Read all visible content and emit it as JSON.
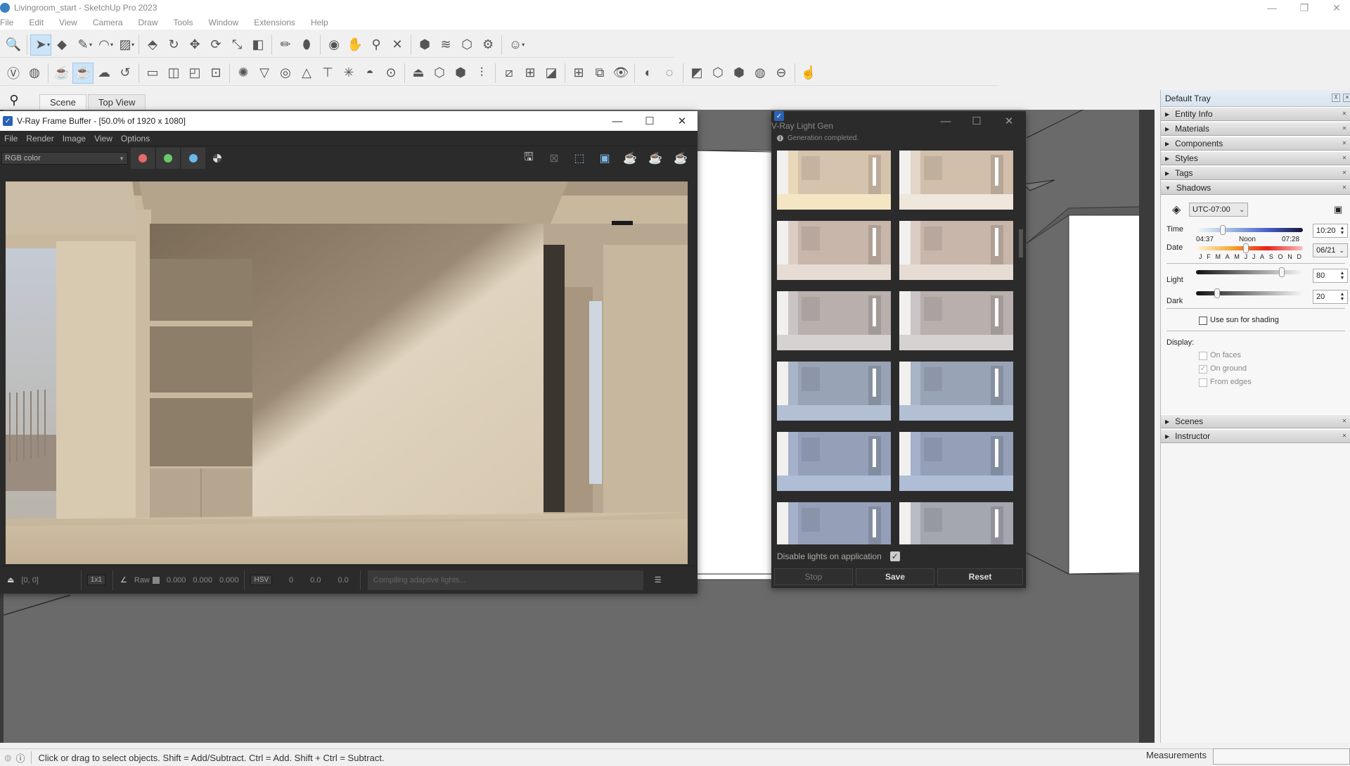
{
  "app": {
    "title": "Livingroom_start - SketchUp Pro 2023",
    "window_controls": [
      "minimize",
      "restore",
      "close"
    ]
  },
  "menubar": [
    "File",
    "Edit",
    "View",
    "Camera",
    "Draw",
    "Tools",
    "Window",
    "Extensions",
    "Help"
  ],
  "toolbar_row1": [
    {
      "name": "zoom-window",
      "glyph": "🔍"
    },
    {
      "name": "select",
      "glyph": "➤",
      "active": true,
      "dropdown": true
    },
    {
      "name": "eraser",
      "glyph": "◆"
    },
    {
      "name": "pencil-line",
      "glyph": "✎",
      "dropdown": true
    },
    {
      "name": "arc",
      "glyph": "◠",
      "dropdown": true
    },
    {
      "name": "rectangle",
      "glyph": "▨",
      "dropdown": true
    },
    {
      "name": "push-pull",
      "glyph": "⬘"
    },
    {
      "name": "follow-me",
      "glyph": "↻"
    },
    {
      "name": "move",
      "glyph": "✥"
    },
    {
      "name": "rotate",
      "glyph": "⟳"
    },
    {
      "name": "scale",
      "glyph": "⤡"
    },
    {
      "name": "offset",
      "glyph": "◧"
    },
    {
      "name": "tape-measure",
      "glyph": "✏"
    },
    {
      "name": "paint-bucket",
      "glyph": "⬮"
    },
    {
      "name": "orbit",
      "glyph": "◉"
    },
    {
      "name": "pan",
      "glyph": "✋"
    },
    {
      "name": "zoom",
      "glyph": "⚲"
    },
    {
      "name": "zoom-extents",
      "glyph": "✕"
    },
    {
      "name": "warehouse",
      "glyph": "⬢"
    },
    {
      "name": "extension-warehouse",
      "glyph": "≋"
    },
    {
      "name": "share-model",
      "glyph": "⬡"
    },
    {
      "name": "extension-manager",
      "glyph": "⚙"
    },
    {
      "name": "account",
      "glyph": "☺",
      "dropdown": true
    }
  ],
  "toolbar_row2": [
    {
      "name": "vray-render",
      "glyph": "Ⓥ"
    },
    {
      "name": "vray-asset-editor",
      "glyph": "◍"
    },
    {
      "name": "render-teapot",
      "glyph": "☕"
    },
    {
      "name": "interactive-render",
      "glyph": "☕",
      "active": true
    },
    {
      "name": "render-cloud",
      "glyph": "☁"
    },
    {
      "name": "batch-render",
      "glyph": "↺"
    },
    {
      "name": "frame-buffer",
      "glyph": "▭"
    },
    {
      "name": "lighting-analysis",
      "glyph": "◫"
    },
    {
      "name": "render-history",
      "glyph": "◰"
    },
    {
      "name": "lock-view",
      "glyph": "⊡"
    },
    {
      "name": "light-gen",
      "glyph": "✺"
    },
    {
      "name": "spot-light",
      "glyph": "▽"
    },
    {
      "name": "omni-light",
      "glyph": "◎"
    },
    {
      "name": "ies-light",
      "glyph": "△"
    },
    {
      "name": "dome-light",
      "glyph": "⊤"
    },
    {
      "name": "sphere-light",
      "glyph": "✳"
    },
    {
      "name": "mesh-light",
      "glyph": "◓"
    },
    {
      "name": "ambient-light",
      "glyph": "⊙"
    },
    {
      "name": "infinite-plane",
      "glyph": "⏏"
    },
    {
      "name": "proxy-export",
      "glyph": "⬡"
    },
    {
      "name": "proxy-import",
      "glyph": "⬢"
    },
    {
      "name": "fur",
      "glyph": "⫶"
    },
    {
      "name": "clipper",
      "glyph": "⧄"
    },
    {
      "name": "decal",
      "glyph": "⊞"
    },
    {
      "name": "mesh-clipper",
      "glyph": "◪"
    },
    {
      "name": "scatter",
      "glyph": "⊞"
    },
    {
      "name": "copy-scene",
      "glyph": "⧉"
    },
    {
      "name": "view-scene",
      "glyph": "👁"
    },
    {
      "name": "material-override",
      "glyph": "◐"
    },
    {
      "name": "select-by-material",
      "glyph": "◌"
    },
    {
      "name": "uvw-planar",
      "glyph": "◩"
    },
    {
      "name": "uvw-box",
      "glyph": "⬡"
    },
    {
      "name": "uvw-box-2",
      "glyph": "⬢"
    },
    {
      "name": "uvw-sphere",
      "glyph": "◍"
    },
    {
      "name": "uvw-cylinder",
      "glyph": "⊖"
    },
    {
      "name": "object-picker",
      "glyph": "☝"
    }
  ],
  "scene_search_icon": "search-icon",
  "scene_tabs": [
    {
      "label": "Scene",
      "active": true
    },
    {
      "label": "Top View",
      "active": false
    }
  ],
  "vfb": {
    "title": "V-Ray Frame Buffer - [50.0% of 1920 x 1080]",
    "menu": [
      "File",
      "Render",
      "Image",
      "View",
      "Options"
    ],
    "channel": "RGB color",
    "channel_colors": [
      "#e86a6a",
      "#6ac86a",
      "#6ab8e8"
    ],
    "status": {
      "coords": "[0, 0]",
      "sample": "1x1",
      "raw_label": "Raw",
      "rgb": [
        "0.000",
        "0.000",
        "0.000"
      ],
      "color_mode": "HSV",
      "hsv": [
        "0",
        "0.0",
        "0.0"
      ],
      "message": "Compiling adaptive lights..."
    }
  },
  "lightgen": {
    "title": "V-Ray Light Gen",
    "info": "Generation completed.",
    "thumbnails": [
      {
        "tone": "warm-bright"
      },
      {
        "tone": "warm"
      },
      {
        "tone": "warm-soft"
      },
      {
        "tone": "warm-soft"
      },
      {
        "tone": "neutral"
      },
      {
        "tone": "neutral"
      },
      {
        "tone": "cool"
      },
      {
        "tone": "cool"
      },
      {
        "tone": "cool-blue"
      },
      {
        "tone": "cool-blue"
      },
      {
        "tone": "cool-blue"
      },
      {
        "tone": "neutral-cool"
      }
    ],
    "disable_lights_label": "Disable lights on application",
    "disable_lights_checked": true,
    "buttons": {
      "stop": "Stop",
      "save": "Save",
      "reset": "Reset"
    }
  },
  "tray": {
    "title": "Default Tray",
    "panels_top": [
      {
        "label": "Entity Info",
        "expanded": false
      },
      {
        "label": "Materials",
        "expanded": false
      },
      {
        "label": "Components",
        "expanded": false
      },
      {
        "label": "Styles",
        "expanded": false
      },
      {
        "label": "Tags",
        "expanded": false
      },
      {
        "label": "Shadows",
        "expanded": true
      }
    ],
    "shadows": {
      "timezone": "UTC-07:00",
      "time_label": "Time",
      "time_ticks": [
        "04:37",
        "Noon",
        "07:28"
      ],
      "time_value": "10:20",
      "time_fraction": 0.25,
      "date_label": "Date",
      "months": [
        "J",
        "F",
        "M",
        "A",
        "M",
        "J",
        "J",
        "A",
        "S",
        "O",
        "N",
        "D"
      ],
      "date_value": "06/21",
      "date_fraction": 0.47,
      "light_label": "Light",
      "light_value": "80",
      "dark_label": "Dark",
      "dark_value": "20",
      "use_sun_label": "Use sun for shading",
      "use_sun_checked": false,
      "display_label": "Display:",
      "on_faces_label": "On faces",
      "on_faces_checked": false,
      "on_ground_label": "On ground",
      "on_ground_checked": true,
      "from_edges_label": "From edges",
      "from_edges_checked": false
    },
    "panels_bottom": [
      {
        "label": "Scenes",
        "expanded": false
      },
      {
        "label": "Instructor",
        "expanded": false
      }
    ]
  },
  "statusbar": {
    "message": "Click or drag to select objects. Shift = Add/Subtract. Ctrl = Add. Shift + Ctrl = Subtract.",
    "measurements_label": "Measurements",
    "measurements_value": ""
  }
}
